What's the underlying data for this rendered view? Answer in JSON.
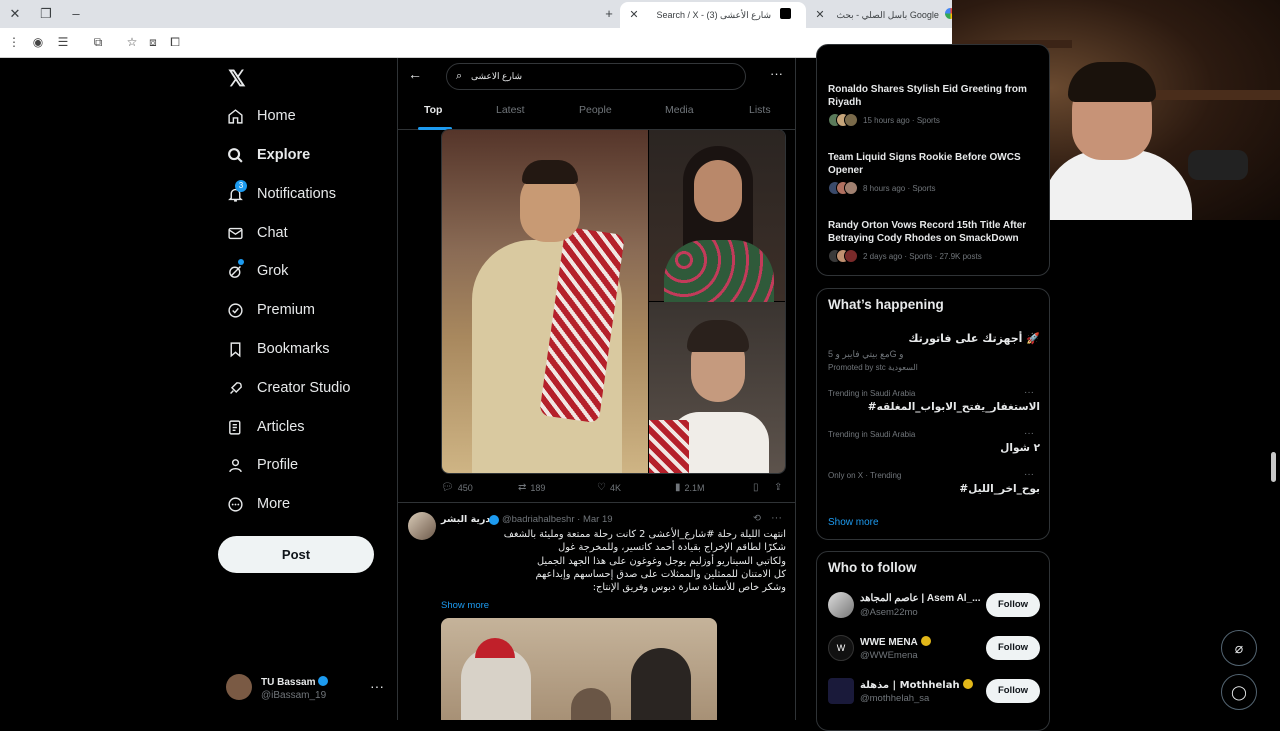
{
  "browser": {
    "tabs": [
      {
        "title": "Search / X - شارع الأعشى (3)",
        "active": true
      },
      {
        "title": "باسل الصلي - بحث Google",
        "active": false
      }
    ]
  },
  "nav": {
    "items": [
      {
        "label": "Home",
        "icon": "home-icon",
        "active": false
      },
      {
        "label": "Explore",
        "icon": "search-icon",
        "active": true
      },
      {
        "label": "Notifications",
        "icon": "bell-icon",
        "badge": "3"
      },
      {
        "label": "Chat",
        "icon": "mail-icon"
      },
      {
        "label": "Grok",
        "icon": "grok-icon"
      },
      {
        "label": "Premium",
        "icon": "premium-icon"
      },
      {
        "label": "Bookmarks",
        "icon": "bookmark-icon"
      },
      {
        "label": "Creator Studio",
        "icon": "rocket-icon"
      },
      {
        "label": "Articles",
        "icon": "article-icon"
      },
      {
        "label": "Profile",
        "icon": "profile-icon"
      },
      {
        "label": "More",
        "icon": "more-icon"
      }
    ],
    "post_label": "Post",
    "account": {
      "name": "TU Bassam",
      "handle": "@iBassam_19"
    }
  },
  "search": {
    "query": "شارع الاعشى",
    "tabs": [
      "Top",
      "Latest",
      "People",
      "Media",
      "Lists"
    ]
  },
  "tweet1": {
    "replies": "450",
    "reposts": "189",
    "likes": "4K",
    "views": "2.1M"
  },
  "tweet2": {
    "name": "بدرية البشر",
    "handle": "@badriahalbeshr",
    "date": "Mar 19",
    "lines": [
      "انتهت الليلة رحلة #شارع_الأعشى 2 كانت رحلة ممتعة ومليئة بالشغف",
      "شكرًا لطاقم الإخراج بقيادة أحمد كاتسير، وللمخرجة غول",
      "ولكاتبي السيناريو أوزليم يوجل وغوغون على هذا الجهد الجميل",
      "كل الامتنان للممثلين والممثلات على صدق إحساسهم وإبداعهم",
      "وشكر خاص للأستاذة سارة دبوس وفريق الإنتاج:"
    ],
    "show_more": "Show more"
  },
  "news": [
    {
      "title": "Ronaldo Shares Stylish Eid Greeting from Riyadh",
      "meta": "15 hours ago · Sports"
    },
    {
      "title": "Team Liquid Signs Rookie Before OWCS Opener",
      "meta": "8 hours ago · Sports"
    },
    {
      "title": "Randy Orton Vows Record 15th Title After Betraying Cody Rhodes on SmackDown",
      "meta": "2 days ago · Sports · 27.9K posts"
    }
  ],
  "happening": {
    "title": "What’s happening",
    "promo": {
      "title": "أجهزتك على فاتورتك 🚀",
      "sub": "مع بيتي فايبر و 5G و",
      "by": "Promoted by stc السعودية"
    },
    "trends": [
      {
        "context": "Trending in Saudi Arabia",
        "name": "#الاستغفار_يفتح_الابواب_المغلقه"
      },
      {
        "context": "Trending in Saudi Arabia",
        "name": "٢ شوال"
      },
      {
        "context": "Only on X · Trending",
        "name": "#بوح_اخر_الليل"
      }
    ],
    "show_more": "Show more"
  },
  "who_to_follow": {
    "title": "Who to follow",
    "users": [
      {
        "name": "عاصم المجاهد | Asem Al_...",
        "handle": "@Asem22mo",
        "button": "Follow"
      },
      {
        "name": "WWE MENA",
        "handle": "@WWEmena",
        "button": "Follow"
      },
      {
        "name": "مذهلة | Mothhelah",
        "handle": "@mothhelah_sa",
        "button": "Follow"
      }
    ]
  },
  "colors": {
    "accent": "#1d9bf0",
    "verified_gold": "#e2b719",
    "background": "#000000"
  }
}
